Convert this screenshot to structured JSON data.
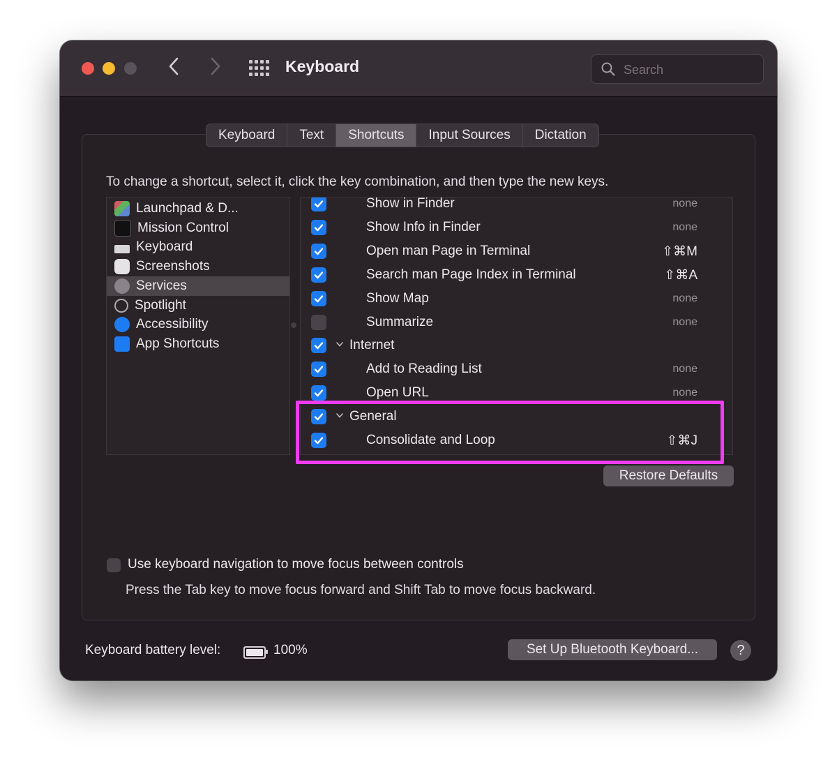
{
  "window": {
    "title": "Keyboard",
    "search_placeholder": "Search"
  },
  "tabs": [
    {
      "label": "Keyboard",
      "active": false
    },
    {
      "label": "Text",
      "active": false
    },
    {
      "label": "Shortcuts",
      "active": true
    },
    {
      "label": "Input Sources",
      "active": false
    },
    {
      "label": "Dictation",
      "active": false
    }
  ],
  "instructions": "To change a shortcut, select it, click the key combination, and then type the new keys.",
  "categories": [
    {
      "label": "Launchpad & D...",
      "icon": "launchpad-icon"
    },
    {
      "label": "Mission Control",
      "icon": "mission-control-icon"
    },
    {
      "label": "Keyboard",
      "icon": "keyboard-icon"
    },
    {
      "label": "Screenshots",
      "icon": "screenshot-icon"
    },
    {
      "label": "Services",
      "icon": "gear-icon",
      "selected": true
    },
    {
      "label": "Spotlight",
      "icon": "magnifier-icon"
    },
    {
      "label": "Accessibility",
      "icon": "accessibility-icon"
    },
    {
      "label": "App Shortcuts",
      "icon": "app-store-icon"
    }
  ],
  "shortcuts": [
    {
      "label": "Show in Finder",
      "checked": true,
      "key": "none",
      "type": "child"
    },
    {
      "label": "Show Info in Finder",
      "checked": true,
      "key": "none",
      "type": "child"
    },
    {
      "label": "Open man Page in Terminal",
      "checked": true,
      "key": "⇧⌘M",
      "type": "child"
    },
    {
      "label": "Search man Page Index in Terminal",
      "checked": true,
      "key": "⇧⌘A",
      "type": "child"
    },
    {
      "label": "Show Map",
      "checked": true,
      "key": "none",
      "type": "child"
    },
    {
      "label": "Summarize",
      "checked": false,
      "key": "none",
      "type": "child"
    },
    {
      "label": "Internet",
      "checked": true,
      "key": "",
      "type": "group"
    },
    {
      "label": "Add to Reading List",
      "checked": true,
      "key": "none",
      "type": "child"
    },
    {
      "label": "Open URL",
      "checked": true,
      "key": "none",
      "type": "child"
    },
    {
      "label": "General",
      "checked": true,
      "key": "",
      "type": "group"
    },
    {
      "label": "Consolidate and Loop",
      "checked": true,
      "key": "⇧⌘J",
      "type": "child"
    }
  ],
  "restore_defaults": "Restore Defaults",
  "keyboard_navigation": {
    "label": "Use keyboard navigation to move focus between controls",
    "checked": false,
    "description": "Press the Tab key to move focus forward and Shift Tab to move focus backward."
  },
  "battery": {
    "label": "Keyboard battery level:",
    "percent": "100%",
    "level": 1.0
  },
  "bluetooth_button": "Set Up Bluetooth Keyboard...",
  "help_button": "?",
  "colors": {
    "accent": "#1e7cf2",
    "highlight": "#f03cf0"
  }
}
